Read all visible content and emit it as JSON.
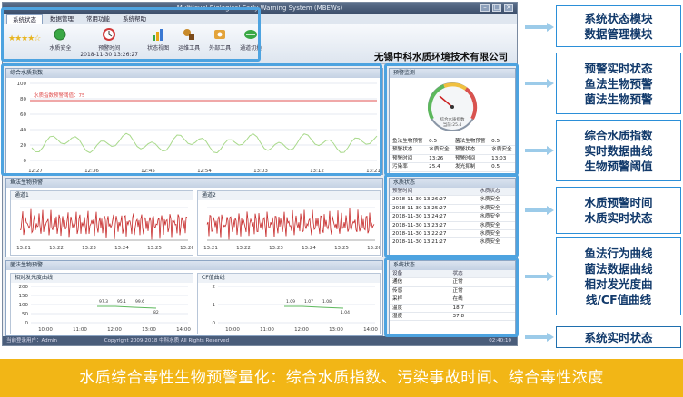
{
  "window": {
    "title": "Multilevel Biological Early Warning System (MBEWs)"
  },
  "menu": {
    "items": [
      "系统状态",
      "数据管理",
      "常用功能",
      "系统帮助"
    ]
  },
  "ribbon": {
    "water_safe": "水质安全",
    "warning_time_label": "预警时间",
    "warning_time_value": "2018-11-30 13:26:27",
    "tools": [
      "状态视图",
      "运维工具",
      "外部工具",
      "通道切换"
    ]
  },
  "company": "无锡中科水质环境技术有限公司",
  "wqi_panel": {
    "title": "综合水质指数",
    "threshold_label": "水质指数预警阈值：75",
    "y_ticks": [
      "100",
      "80",
      "60",
      "40",
      "20",
      "0"
    ],
    "x_ticks": [
      "12:27",
      "12:36",
      "12:45",
      "12:54",
      "13:03",
      "13:12",
      "13:21"
    ]
  },
  "fish_panel": {
    "title": "鱼法生物预警",
    "channel1": "通道1",
    "channel2": "通道2",
    "x_ticks": [
      "13:21",
      "13:22",
      "13:23",
      "13:24",
      "13:25",
      "13:26"
    ]
  },
  "bacteria_panel": {
    "title": "菌法生物预警",
    "rel_title": "相对发光度曲线",
    "cf_title": "CF值曲线",
    "rel_y": [
      "200",
      "150",
      "100",
      "50",
      "0"
    ],
    "cf_y": [
      "2",
      "1",
      "0"
    ],
    "x_ticks": [
      "10:00",
      "11:00",
      "12:00",
      "13:00",
      "14:00"
    ],
    "rel_labels": [
      "97.3",
      "95.1",
      "99.6",
      "82"
    ],
    "cf_labels": [
      "1.09",
      "1.07",
      "1.08",
      "1.04"
    ]
  },
  "warning_panel": {
    "title": "预警监测",
    "gauge_text1": "综合水质指数",
    "gauge_text2": "当前:25.4",
    "rows": [
      {
        "l1": "鱼法生物预警",
        "v1": "0.5",
        "l2": "菌法生物预警",
        "v2": "0.5"
      },
      {
        "l1": "预警状态",
        "v1": "水质安全",
        "l2": "预警状态",
        "v2": "水质安全"
      },
      {
        "l1": "预警时间",
        "v1": "13:26",
        "l2": "预警时间",
        "v2": "13:03"
      },
      {
        "l1": "污染率",
        "v1": "25.4",
        "l2": "发光抑制",
        "v2": "0.5"
      }
    ]
  },
  "quality_panel": {
    "title": "水质状态",
    "col_time": "预警时间",
    "col_state": "水质状态",
    "rows": [
      {
        "time": "2018-11-30 13:26:27",
        "state": "水质安全"
      },
      {
        "time": "2018-11-30 13:25:27",
        "state": "水质安全"
      },
      {
        "time": "2018-11-30 13:24:27",
        "state": "水质安全"
      },
      {
        "time": "2018-11-30 13:23:27",
        "state": "水质安全"
      },
      {
        "time": "2018-11-30 13:22:27",
        "state": "水质安全"
      },
      {
        "time": "2018-11-30 13:21:27",
        "state": "水质安全"
      }
    ]
  },
  "system_panel": {
    "title": "系统状态",
    "col_dev": "设备",
    "col_state": "状态",
    "rows": [
      {
        "dev": "通信",
        "state": "正常"
      },
      {
        "dev": "传感",
        "state": "正常"
      },
      {
        "dev": "采样",
        "state": "在线"
      },
      {
        "dev": "温度",
        "state": "18.7"
      },
      {
        "dev": "湿度",
        "state": "37.8"
      }
    ]
  },
  "statusbar": {
    "user": "当前登录用户：Admin",
    "copyright": "Copyright 2009-2018 中科水质 All Rights Reserved",
    "time": "02:40:10"
  },
  "callouts": [
    [
      "系统状态模块",
      "数据管理模块"
    ],
    [
      "预警实时状态",
      "鱼法生物预警",
      "菌法生物预警"
    ],
    [
      "综合水质指数",
      "实时数据曲线",
      "生物预警阈值"
    ],
    [
      "水质预警时间",
      "水质实时状态"
    ],
    [
      "鱼法行为曲线",
      "菌法数据曲线",
      "相对发光度曲",
      "线/CF值曲线"
    ],
    [
      "系统实时状态"
    ]
  ],
  "banner": "水质综合毒性生物预警量化：综合水质指数、污染事故时间、综合毒性浓度",
  "colors": {
    "accent": "#2b8fd8",
    "banner": "#f2b616",
    "threshold": "#e05050",
    "series": "#a8d98a"
  }
}
